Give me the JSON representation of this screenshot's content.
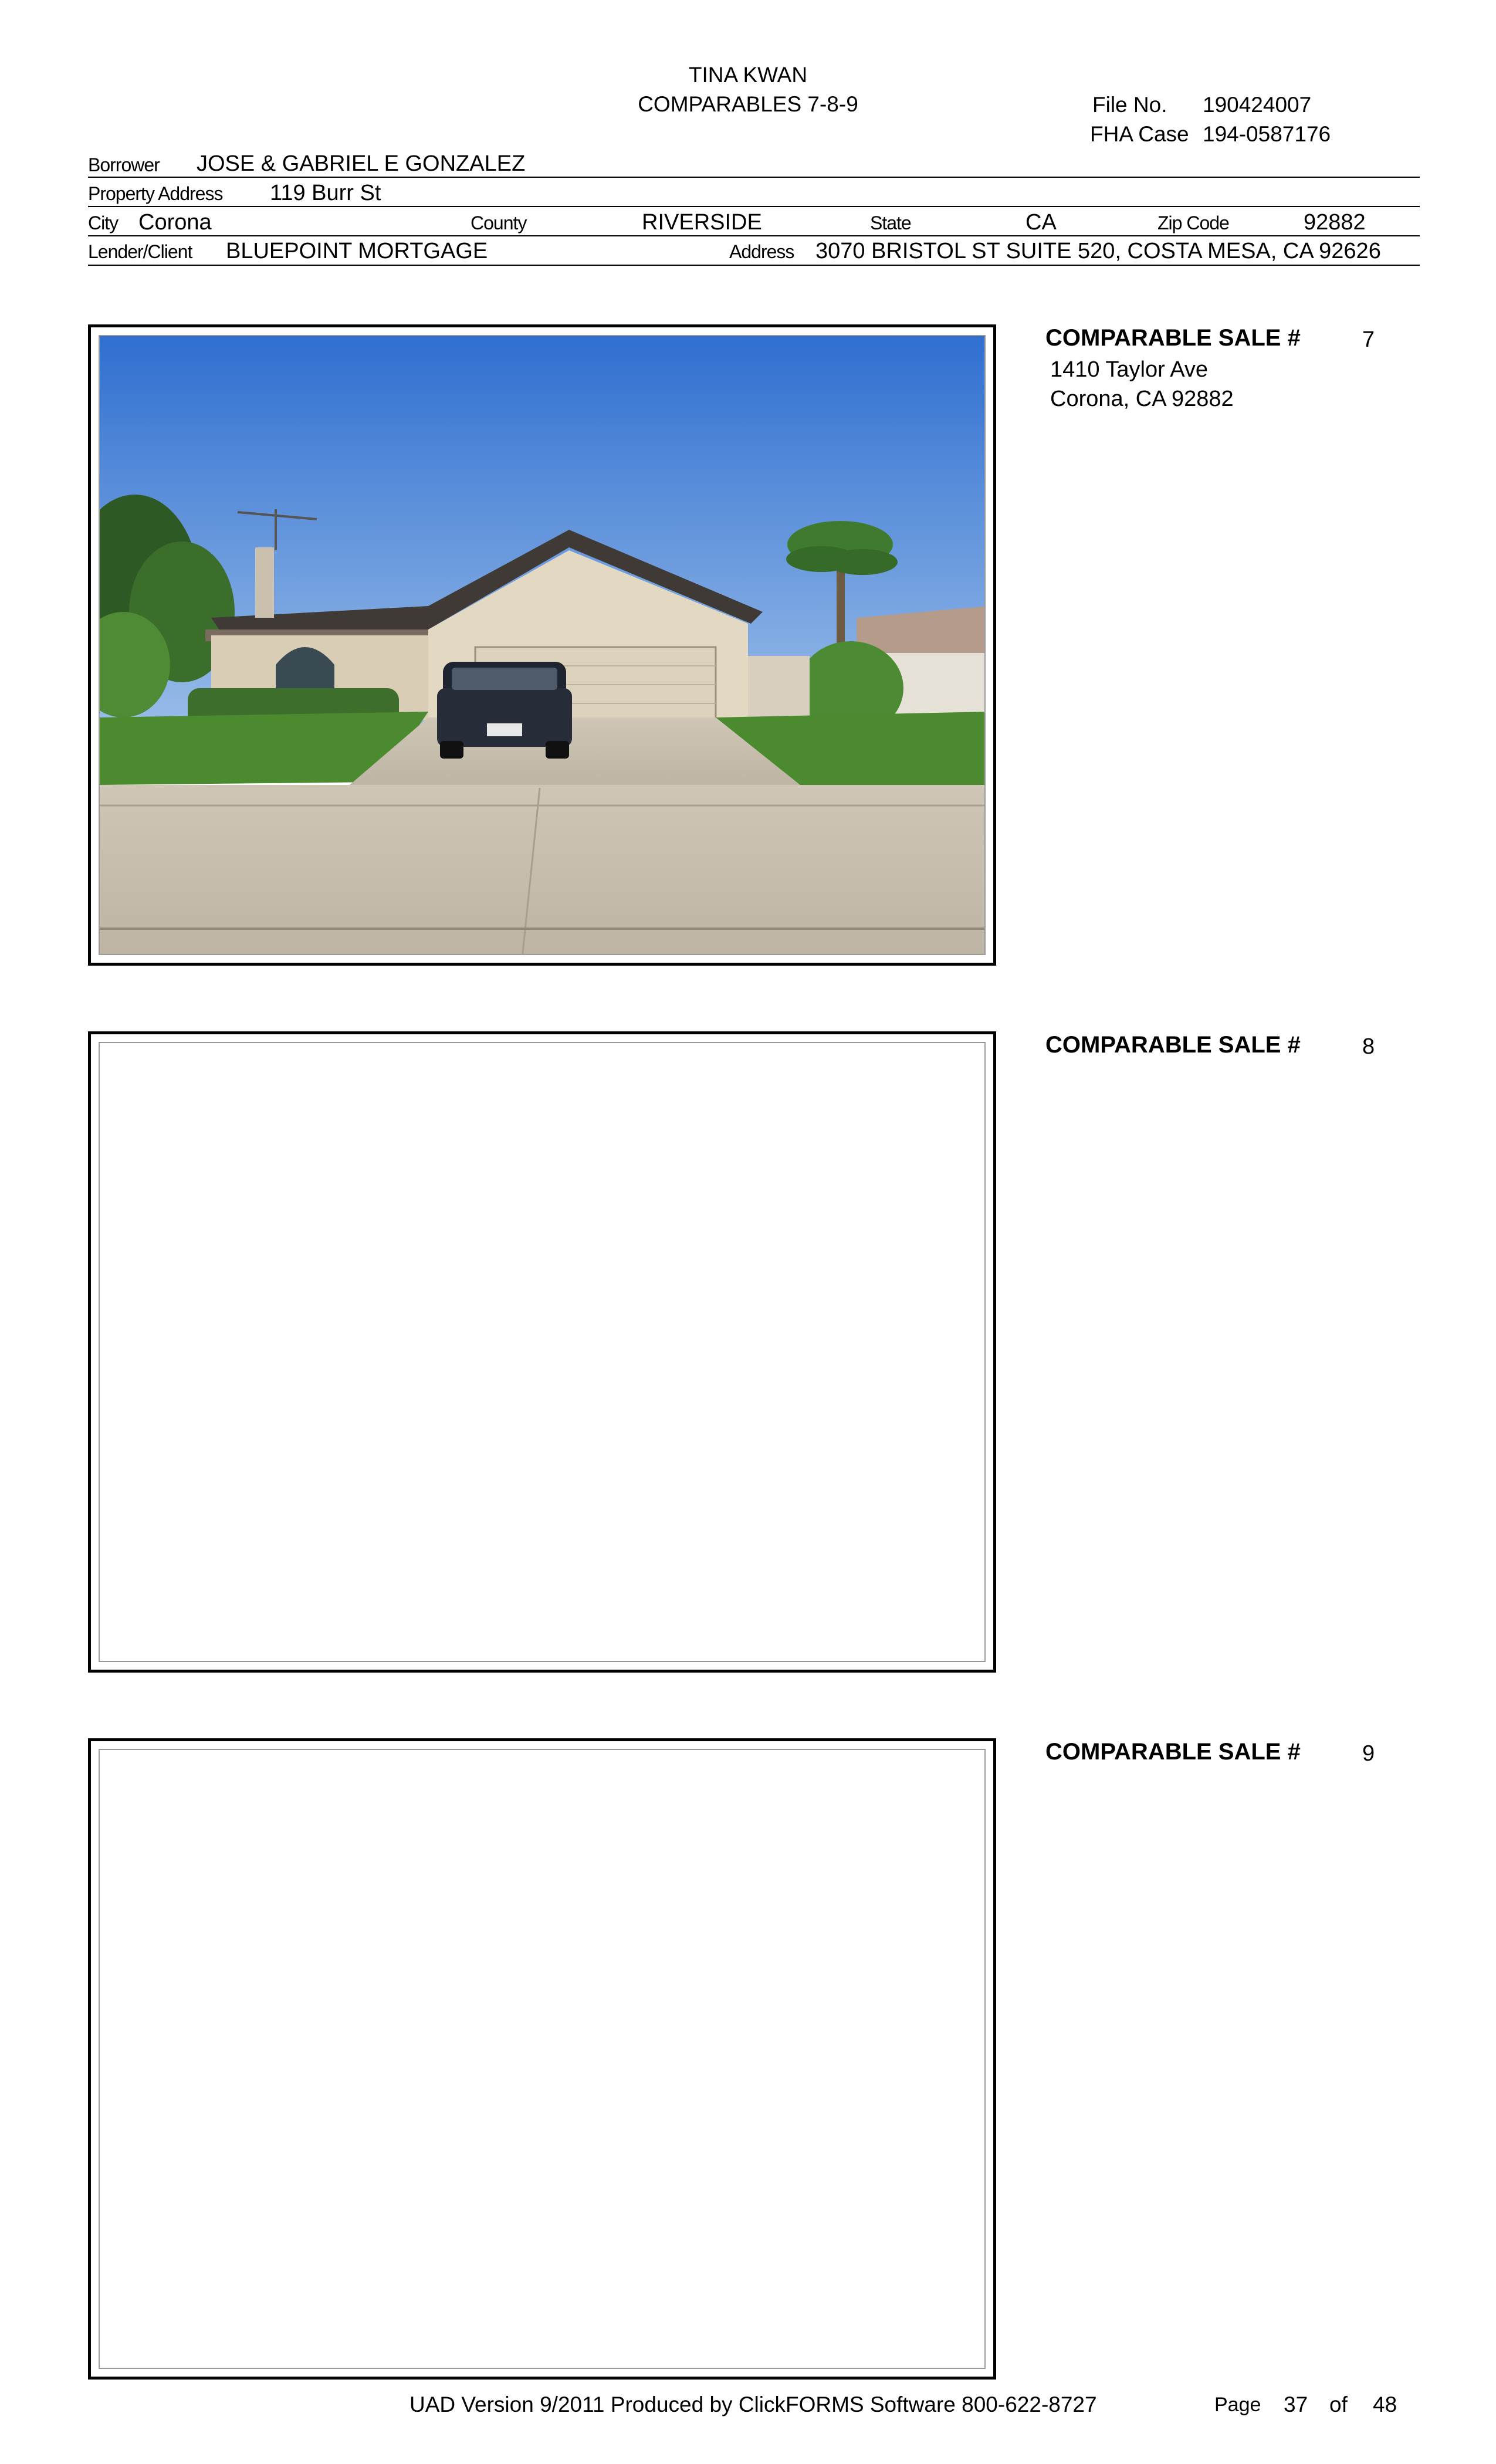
{
  "header": {
    "appraiser": "TINA KWAN",
    "form_title": "COMPARABLES 7-8-9",
    "file_no_label": "File No.",
    "file_no": "190424007",
    "fha_case_label": "FHA Case",
    "fha_case": "194-0587176"
  },
  "subject": {
    "borrower_label": "Borrower",
    "borrower": "JOSE & GABRIEL E GONZALEZ",
    "property_address_label": "Property Address",
    "property_address": "119 Burr St",
    "city_label": "City",
    "city": "Corona",
    "county_label": "County",
    "county": "RIVERSIDE",
    "state_label": "State",
    "state": "CA",
    "zip_label": "Zip Code",
    "zip": "92882",
    "lender_label": "Lender/Client",
    "lender": "BLUEPOINT MORTGAGE",
    "address_label": "Address",
    "lender_address": "3070 BRISTOL ST SUITE 520, COSTA MESA, CA 92626"
  },
  "comparables": [
    {
      "title": "COMPARABLE SALE #",
      "number": "7",
      "address_line1": "1410 Taylor Ave",
      "address_line2": "Corona, CA 92882"
    },
    {
      "title": "COMPARABLE SALE #",
      "number": "8",
      "address_line1": "",
      "address_line2": ""
    },
    {
      "title": "COMPARABLE SALE #",
      "number": "9",
      "address_line1": "",
      "address_line2": ""
    }
  ],
  "footer": {
    "produced_by": "UAD Version 9/2011 Produced by ClickFORMS Software 800-622-8727",
    "page_label": "Page",
    "page": "37",
    "of_label": "of",
    "total_pages": "48"
  }
}
